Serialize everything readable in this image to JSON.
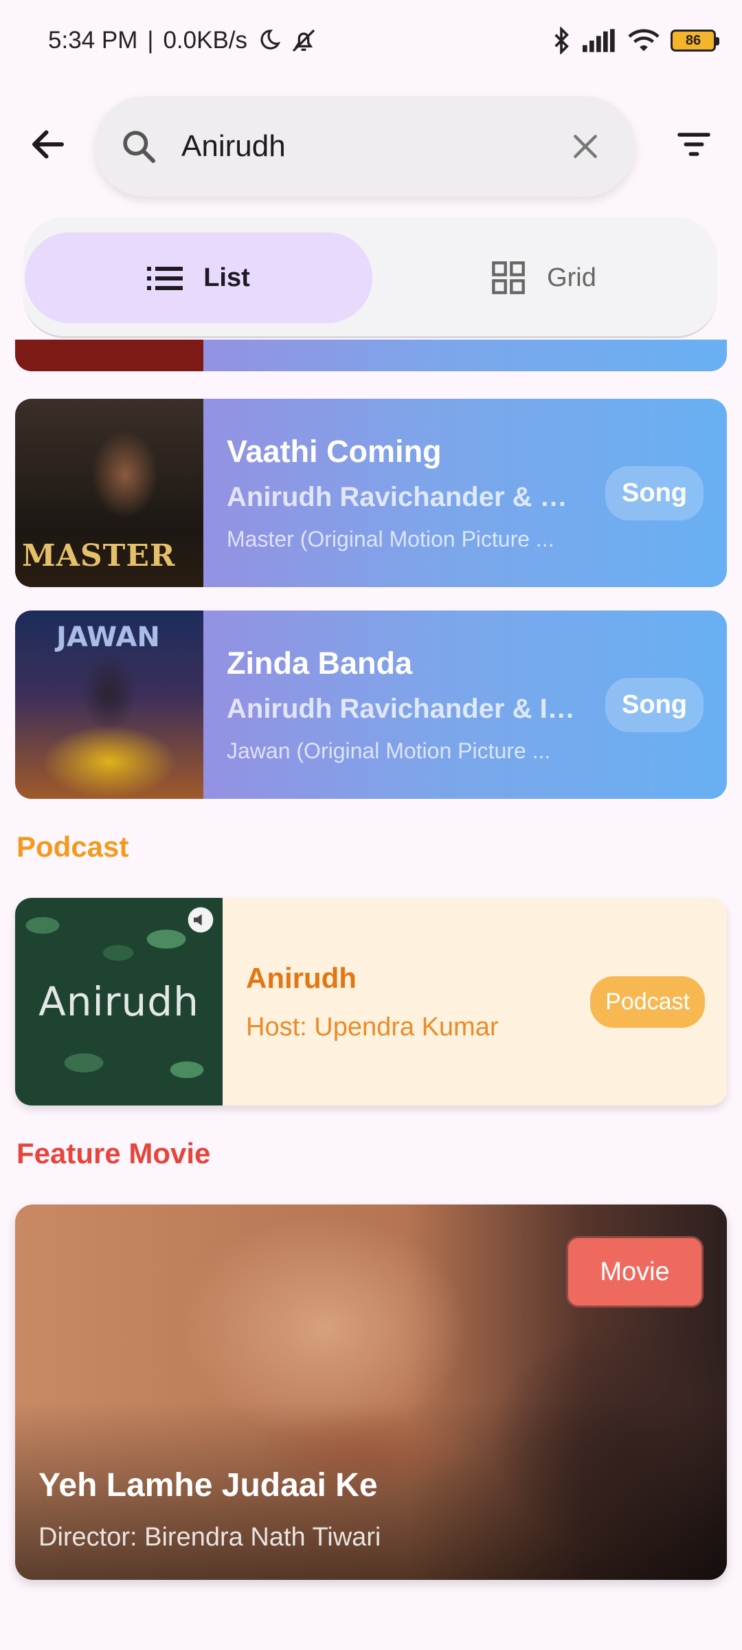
{
  "status_bar": {
    "time": "5:34 PM",
    "separator": "|",
    "speed": "0.0KB/s",
    "battery": "86",
    "icons": [
      "moon-icon",
      "silent-bell-icon",
      "bluetooth-icon",
      "signal-icon",
      "wifi-icon",
      "battery-icon"
    ]
  },
  "search": {
    "value": "Anirudh",
    "icons": [
      "back-arrow-icon",
      "search-icon",
      "clear-icon",
      "filter-icon"
    ]
  },
  "view_toggle": {
    "list_label": "List",
    "grid_label": "Grid",
    "selected": "List"
  },
  "songs": [
    {
      "title": "Vaathi Coming",
      "artist": "Anirudh Ravichander & G...",
      "album": "Master (Original Motion Picture ...",
      "badge": "Song",
      "art_text": "MASTER"
    },
    {
      "title": "Zinda Banda",
      "artist": "Anirudh Ravichander & Ir...",
      "album": "Jawan (Original Motion Picture ...",
      "badge": "Song",
      "art_text": "JAWAN"
    }
  ],
  "podcast_section": {
    "title": "Podcast",
    "item": {
      "art_text": "Anirudh",
      "title": "Anirudh",
      "host": "Host: Upendra Kumar",
      "badge": "Podcast"
    }
  },
  "movie_section": {
    "title": "Feature Movie",
    "item": {
      "title": "Yeh Lamhe Judaai Ke",
      "director": "Director: Birendra Nath Tiwari",
      "badge": "Movie"
    }
  },
  "colors": {
    "background": "#FDF6FC",
    "podcast_accent": "#F39A1E",
    "movie_accent": "#E5453B",
    "toggle_selected": "#E8DAFC"
  }
}
